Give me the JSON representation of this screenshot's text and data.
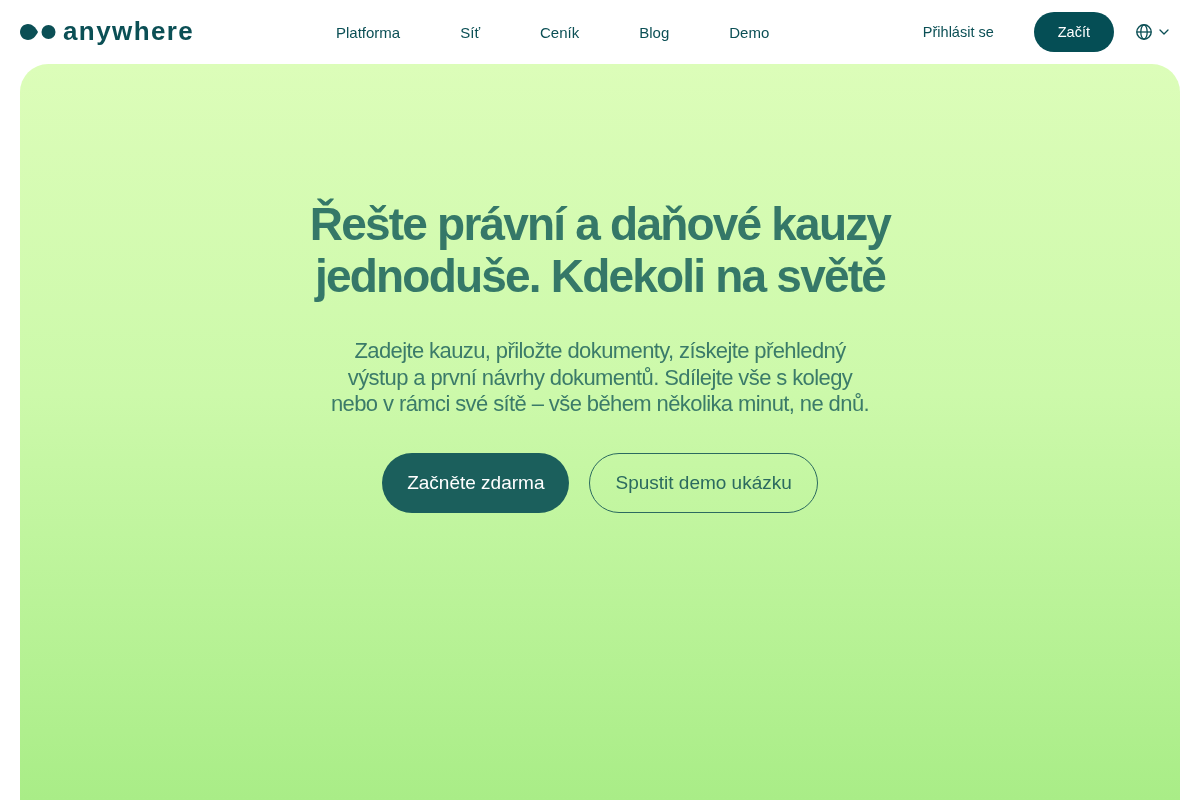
{
  "header": {
    "logo": {
      "text": "anywhere"
    },
    "nav": [
      {
        "label": "Platforma"
      },
      {
        "label": "Síť"
      },
      {
        "label": "Ceník"
      },
      {
        "label": "Blog"
      },
      {
        "label": "Demo"
      }
    ],
    "login": "Přihlásit se",
    "cta": "Začít"
  },
  "hero": {
    "title": "Řešte právní a daňové kauzy jednoduše. Kdekoli na světě",
    "description": "Zadejte kauzu, přiložte dokumenty, získejte přehledný výstup a první návrhy dokumentů. Sdílejte vše s kolegy nebo v rámci své sítě – vše během několika minut, ne dnů.",
    "buttons": [
      {
        "label": "Začněte zdarma",
        "kind": "primary"
      },
      {
        "label": "Spustit demo ukázku",
        "kind": "outline"
      }
    ]
  }
}
